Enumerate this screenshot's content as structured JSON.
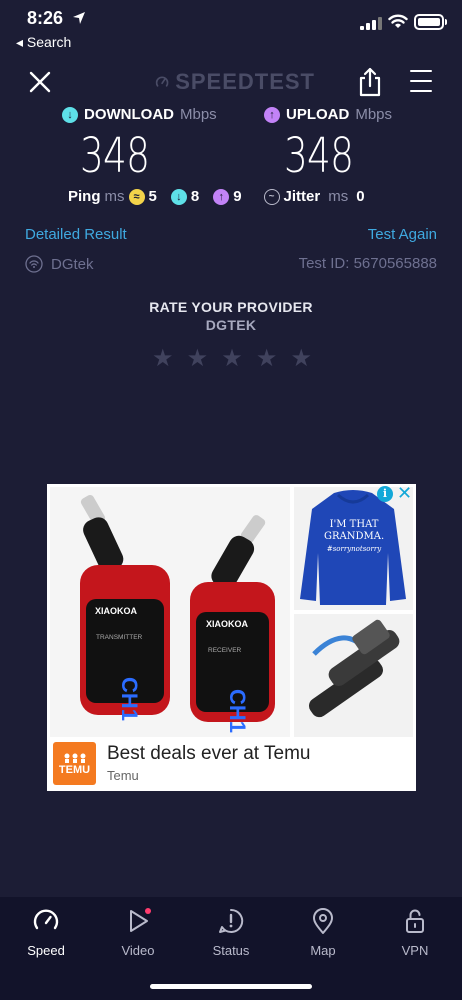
{
  "status_bar": {
    "time": "8:26",
    "back_label": "◂ Search"
  },
  "header": {
    "logo_text": "SPEEDTEST"
  },
  "results": {
    "download_label": "DOWNLOAD",
    "upload_label": "UPLOAD",
    "unit": "Mbps",
    "download_value": "348",
    "upload_value": "348",
    "ping_label": "Ping",
    "ping_unit": "ms",
    "ping_idle": "5",
    "ping_download": "8",
    "ping_upload": "9",
    "jitter_label": "Jitter",
    "jitter_unit": "ms",
    "jitter_value": "0"
  },
  "links": {
    "detailed_result": "Detailed Result",
    "test_again": "Test Again"
  },
  "provider": {
    "name": "DGtek",
    "test_id": "Test ID: 5670565888"
  },
  "rating": {
    "title": "RATE YOUR PROVIDER",
    "provider": "DGTEK",
    "stars_total": 5,
    "stars_selected": 0
  },
  "ad": {
    "headline": "Best deals ever at Temu",
    "brand": "Temu",
    "logo_text": "TEMU",
    "product_brand": "XIAOKOA",
    "transmitter_label": "TRANSMITTER",
    "receiver_label": "RECEIVER",
    "transmitter_display": "CH1",
    "receiver_display": "CH1",
    "hoodie_text_1": "I'M THAT",
    "hoodie_text_2": "GRANDMA.",
    "hoodie_text_3": "#sorrynotsorry"
  },
  "nav": {
    "items": [
      {
        "label": "Speed",
        "icon": "speedometer-icon"
      },
      {
        "label": "Video",
        "icon": "play-icon"
      },
      {
        "label": "Status",
        "icon": "alert-icon"
      },
      {
        "label": "Map",
        "icon": "map-pin-icon"
      },
      {
        "label": "VPN",
        "icon": "lock-icon"
      }
    ]
  },
  "colors": {
    "background": "#1c1d35",
    "download_accent": "#5ee0e8",
    "upload_accent": "#c283f7",
    "ping_accent": "#f3d34a",
    "link": "#3fa9e0",
    "notification_dot": "#ff3c6e"
  }
}
